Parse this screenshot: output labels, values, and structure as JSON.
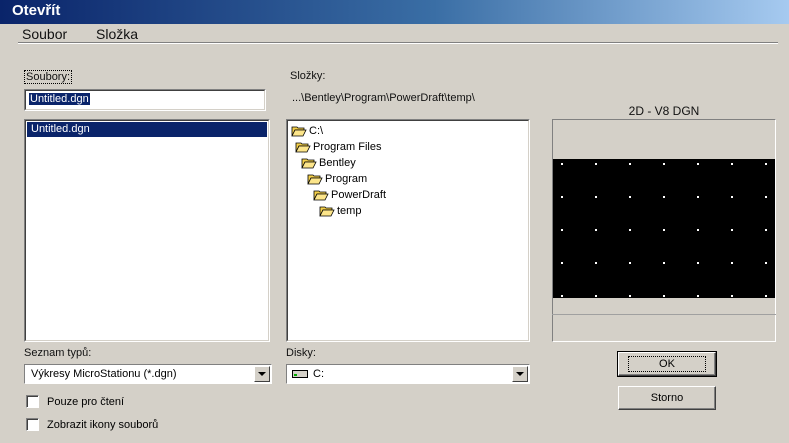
{
  "window": {
    "title": "Otevřít"
  },
  "menu": {
    "items": [
      {
        "label": "Soubor"
      },
      {
        "label": "Složka"
      }
    ]
  },
  "files": {
    "label": "Soubory:",
    "filename_value": "Untitled.dgn",
    "list": [
      "Untitled.dgn"
    ]
  },
  "folders": {
    "label": "Složky:",
    "current_path": "...\\Bentley\\Program\\PowerDraft\\temp\\",
    "tree": [
      {
        "label": "C:\\",
        "open": true
      },
      {
        "label": "Program Files",
        "open": true
      },
      {
        "label": "Bentley",
        "open": true
      },
      {
        "label": "Program",
        "open": true
      },
      {
        "label": "PowerDraft",
        "open": true
      },
      {
        "label": "temp",
        "open": true
      }
    ]
  },
  "preview": {
    "caption": "2D - V8 DGN"
  },
  "file_types": {
    "label": "Seznam typů:",
    "selected": "Výkresy MicroStationu (*.dgn)"
  },
  "drives": {
    "label": "Disky:",
    "selected": "C:"
  },
  "options": {
    "read_only": "Pouze pro čtení",
    "show_icons": "Zobrazit ikony souborů"
  },
  "buttons": {
    "ok": "OK",
    "cancel": "Storno"
  },
  "colors": {
    "title_start": "#0a246a",
    "title_end": "#a6caf0",
    "selection": "#0a246a",
    "face": "#d4d0c8"
  }
}
